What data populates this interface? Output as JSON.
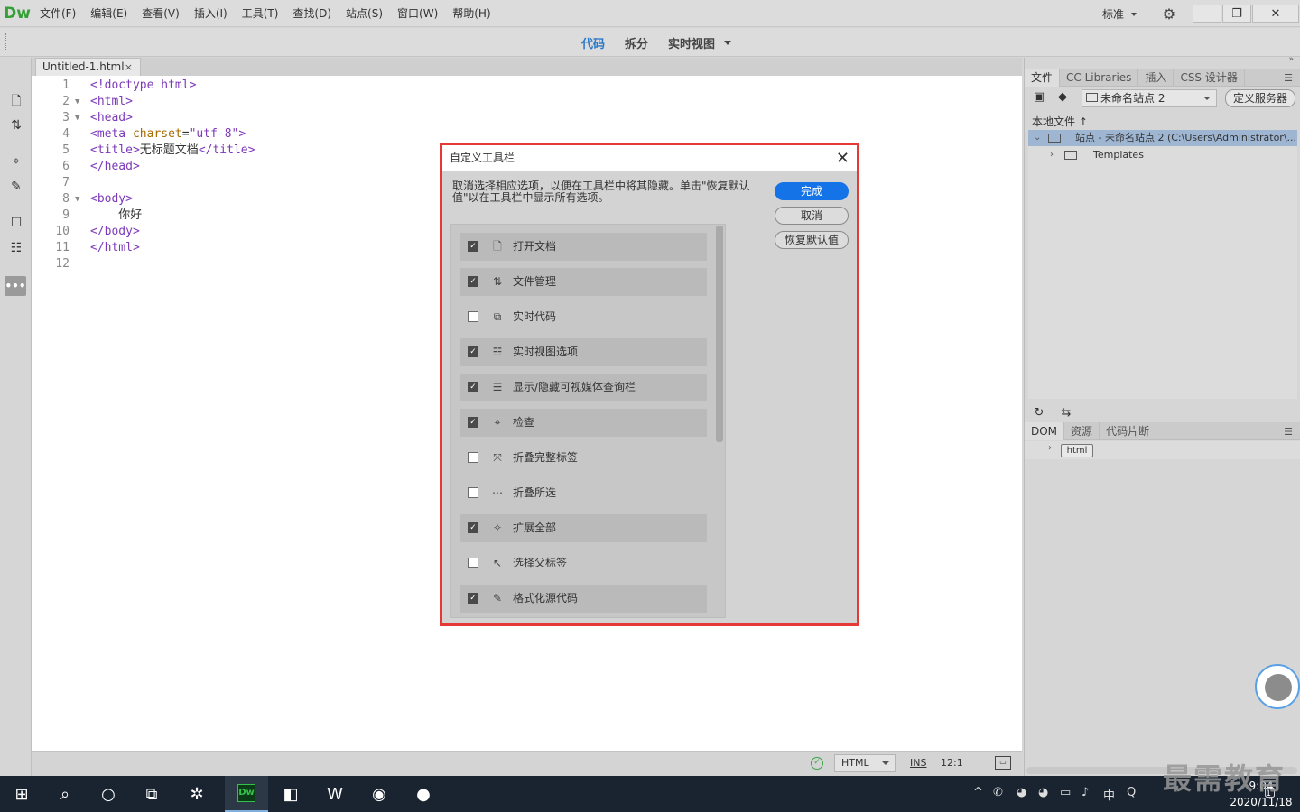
{
  "app": {
    "logo": "Dw"
  },
  "menu": [
    "文件(F)",
    "编辑(E)",
    "查看(V)",
    "插入(I)",
    "工具(T)",
    "查找(D)",
    "站点(S)",
    "窗口(W)",
    "帮助(H)"
  ],
  "workspace": "标准",
  "window_controls": {
    "minimize": "—",
    "restore": "❐",
    "close": "✕"
  },
  "view_tabs": {
    "code": "代码",
    "split": "拆分",
    "live": "实时视图"
  },
  "document": {
    "tab": "Untitled-1.html",
    "tab_close": "×"
  },
  "code_lines": [
    {
      "n": "1",
      "fold": "",
      "parts": [
        {
          "c": "tg",
          "t": "<!doctype html>"
        }
      ]
    },
    {
      "n": "2",
      "fold": "▼",
      "parts": [
        {
          "c": "tg",
          "t": "<html>"
        }
      ]
    },
    {
      "n": "3",
      "fold": "▼",
      "parts": [
        {
          "c": "tg",
          "t": "<head>"
        }
      ]
    },
    {
      "n": "4",
      "fold": "",
      "parts": [
        {
          "c": "tg",
          "t": "<meta "
        },
        {
          "c": "at",
          "t": "charset"
        },
        {
          "c": "tx",
          "t": "="
        },
        {
          "c": "sv",
          "t": "\"utf-8\""
        },
        {
          "c": "tg",
          "t": ">"
        }
      ]
    },
    {
      "n": "5",
      "fold": "",
      "parts": [
        {
          "c": "tg",
          "t": "<title>"
        },
        {
          "c": "tx",
          "t": "无标题文档"
        },
        {
          "c": "tg",
          "t": "</title>"
        }
      ]
    },
    {
      "n": "6",
      "fold": "",
      "parts": [
        {
          "c": "tg",
          "t": "</head>"
        }
      ]
    },
    {
      "n": "7",
      "fold": "",
      "parts": []
    },
    {
      "n": "8",
      "fold": "▼",
      "parts": [
        {
          "c": "tg",
          "t": "<body>"
        }
      ]
    },
    {
      "n": "9",
      "fold": "",
      "parts": [
        {
          "c": "tx",
          "t": "    你好"
        }
      ]
    },
    {
      "n": "10",
      "fold": "",
      "parts": [
        {
          "c": "tg",
          "t": "</body>"
        }
      ]
    },
    {
      "n": "11",
      "fold": "",
      "parts": [
        {
          "c": "tg",
          "t": "</html>"
        }
      ]
    },
    {
      "n": "12",
      "fold": "",
      "parts": []
    }
  ],
  "status": {
    "language": "HTML",
    "ins": "INS",
    "position": "12:1"
  },
  "dialog": {
    "title": "自定义工具栏",
    "close": "✕",
    "description": "取消选择相应选项，以便在工具栏中将其隐藏。单击\"恢复默认值\"以在工具栏中显示所有选项。",
    "buttons": {
      "done": "完成",
      "cancel": "取消",
      "restore": "恢复默认值"
    },
    "options": [
      {
        "label": "打开文档",
        "icon": "open-document-icon",
        "glyph": "🗋",
        "checked": true
      },
      {
        "label": "文件管理",
        "icon": "file-management-icon",
        "glyph": "⇅",
        "checked": true
      },
      {
        "label": "实时代码",
        "icon": "live-code-icon",
        "glyph": "⧉",
        "checked": false
      },
      {
        "label": "实时视图选项",
        "icon": "live-view-options-icon",
        "glyph": "☷",
        "checked": true
      },
      {
        "label": "显示/隐藏可视媒体查询栏",
        "icon": "media-query-bar-icon",
        "glyph": "☰",
        "checked": true
      },
      {
        "label": "检查",
        "icon": "inspect-icon",
        "glyph": "⌖",
        "checked": true
      },
      {
        "label": "折叠完整标签",
        "icon": "collapse-full-tag-icon",
        "glyph": "⤧",
        "checked": false
      },
      {
        "label": "折叠所选",
        "icon": "collapse-selection-icon",
        "glyph": "⋯",
        "checked": false
      },
      {
        "label": "扩展全部",
        "icon": "expand-all-icon",
        "glyph": "✧",
        "checked": true
      },
      {
        "label": "选择父标签",
        "icon": "select-parent-tag-icon",
        "glyph": "↖",
        "checked": false
      },
      {
        "label": "格式化源代码",
        "icon": "format-source-icon",
        "glyph": "✎",
        "checked": true
      }
    ]
  },
  "files_panel": {
    "tabs": [
      "文件",
      "CC Libraries",
      "插入",
      "CSS 设计器"
    ],
    "site": "未命名站点 2",
    "define_server": "定义服务器",
    "local_files": "本地文件",
    "local_files_arrow": "↑",
    "tree": [
      {
        "label": "站点 - 未命名站点 2 (C:\\Users\\Administrator\\...",
        "arrow": "⌄",
        "selected": true
      },
      {
        "label": "Templates",
        "arrow": "›",
        "selected": false
      }
    ]
  },
  "dom_panel": {
    "tabs": [
      "DOM",
      "资源",
      "代码片断"
    ],
    "node": "html",
    "node_arrow": "›"
  },
  "taskbar": {
    "time": "9:04",
    "date": "2020/11/18",
    "ime": "中",
    "notification_count": "1"
  },
  "watermark": "最需教育",
  "colors": {
    "accent": "#1473e6",
    "highlight": "#e53935",
    "dw_green": "#35a035",
    "active_tab": "#2a78c8"
  }
}
